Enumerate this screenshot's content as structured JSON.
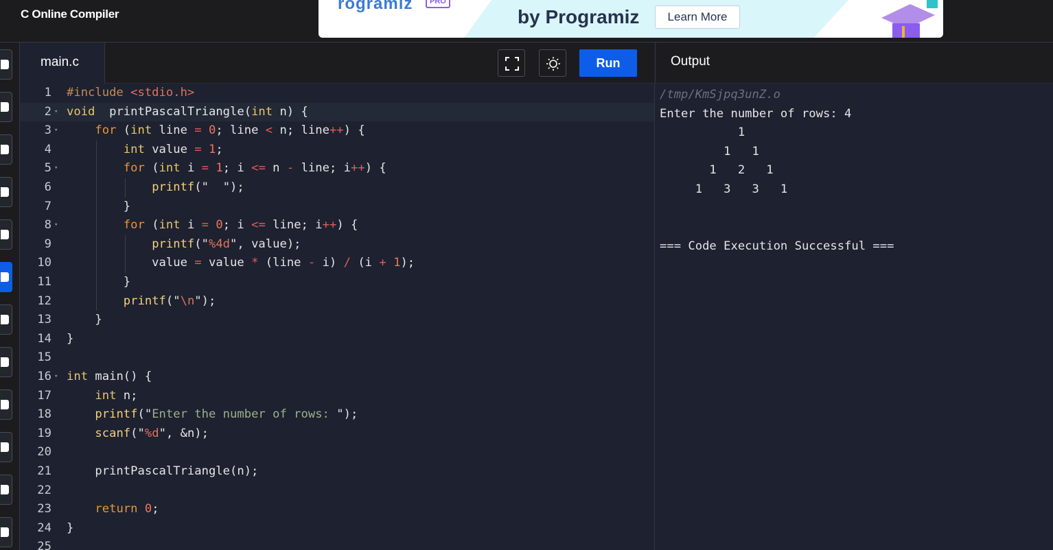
{
  "app": {
    "title": "C Online Compiler"
  },
  "banner": {
    "brand": "rogramiz",
    "pro": "PRO",
    "tagline": "by Programiz",
    "cta": "Learn More"
  },
  "editor": {
    "tab": "main.c",
    "run_label": "Run",
    "lines": [
      {
        "n": "1",
        "fold": false,
        "indent": 0
      },
      {
        "n": "2",
        "fold": true,
        "indent": 0
      },
      {
        "n": "3",
        "fold": true,
        "indent": 1
      },
      {
        "n": "4",
        "fold": false,
        "indent": 2
      },
      {
        "n": "5",
        "fold": true,
        "indent": 2
      },
      {
        "n": "6",
        "fold": false,
        "indent": 3
      },
      {
        "n": "7",
        "fold": false,
        "indent": 2
      },
      {
        "n": "8",
        "fold": true,
        "indent": 2
      },
      {
        "n": "9",
        "fold": false,
        "indent": 3
      },
      {
        "n": "10",
        "fold": false,
        "indent": 3
      },
      {
        "n": "11",
        "fold": false,
        "indent": 2
      },
      {
        "n": "12",
        "fold": false,
        "indent": 2
      },
      {
        "n": "13",
        "fold": false,
        "indent": 1
      },
      {
        "n": "14",
        "fold": false,
        "indent": 0
      },
      {
        "n": "15",
        "fold": false,
        "indent": 0
      },
      {
        "n": "16",
        "fold": true,
        "indent": 0
      },
      {
        "n": "17",
        "fold": false,
        "indent": 1
      },
      {
        "n": "18",
        "fold": false,
        "indent": 1
      },
      {
        "n": "19",
        "fold": false,
        "indent": 1
      },
      {
        "n": "20",
        "fold": false,
        "indent": 0
      },
      {
        "n": "21",
        "fold": false,
        "indent": 1
      },
      {
        "n": "22",
        "fold": false,
        "indent": 0
      },
      {
        "n": "23",
        "fold": false,
        "indent": 1
      },
      {
        "n": "24",
        "fold": false,
        "indent": 0
      },
      {
        "n": "25",
        "fold": false,
        "indent": 0
      }
    ],
    "code": [
      [
        [
          "inc",
          "#include "
        ],
        [
          "hdr",
          "<stdio.h>"
        ]
      ],
      [
        [
          "kw",
          "void"
        ],
        [
          "",
          "  printPascalTriangle("
        ],
        [
          "kw",
          "int"
        ],
        [
          "",
          " n) {"
        ]
      ],
      [
        [
          "",
          "    "
        ],
        [
          "ctl",
          "for"
        ],
        [
          "",
          " ("
        ],
        [
          "kw",
          "int"
        ],
        [
          "",
          " line "
        ],
        [
          "op",
          "="
        ],
        [
          "",
          ""
        ],
        [
          "num",
          " 0"
        ],
        [
          "",
          "; line "
        ],
        [
          "op",
          "<"
        ],
        [
          "",
          " n; line"
        ],
        [
          "op",
          "++"
        ],
        [
          "",
          ") {"
        ]
      ],
      [
        [
          "",
          "        "
        ],
        [
          "kw",
          "int"
        ],
        [
          "",
          " value "
        ],
        [
          "op",
          "="
        ],
        [
          "num",
          " 1"
        ],
        [
          "",
          ";"
        ]
      ],
      [
        [
          "",
          "        "
        ],
        [
          "ctl",
          "for"
        ],
        [
          "",
          " ("
        ],
        [
          "kw",
          "int"
        ],
        [
          "",
          " i "
        ],
        [
          "op",
          "="
        ],
        [
          "num",
          " 1"
        ],
        [
          "",
          "; i "
        ],
        [
          "op",
          "<="
        ],
        [
          "",
          " n "
        ],
        [
          "op",
          "-"
        ],
        [
          "",
          " line; i"
        ],
        [
          "op",
          "++"
        ],
        [
          "",
          ") {"
        ]
      ],
      [
        [
          "",
          "            "
        ],
        [
          "fn",
          "printf"
        ],
        [
          "",
          "(\""
        ],
        [
          "str",
          "  "
        ],
        [
          "",
          "\");"
        ]
      ],
      [
        [
          "",
          "        }"
        ]
      ],
      [
        [
          "",
          "        "
        ],
        [
          "ctl",
          "for"
        ],
        [
          "",
          " ("
        ],
        [
          "kw",
          "int"
        ],
        [
          "",
          " i "
        ],
        [
          "op",
          "="
        ],
        [
          "num",
          " 0"
        ],
        [
          "",
          "; i "
        ],
        [
          "op",
          "<="
        ],
        [
          "",
          " line; i"
        ],
        [
          "op",
          "++"
        ],
        [
          "",
          ") {"
        ]
      ],
      [
        [
          "",
          "            "
        ],
        [
          "fn",
          "printf"
        ],
        [
          "",
          "(\""
        ],
        [
          "str",
          "%4d"
        ],
        [
          "",
          "\", value);"
        ]
      ],
      [
        [
          "",
          "            value "
        ],
        [
          "op",
          "="
        ],
        [
          "",
          " value "
        ],
        [
          "op",
          "*"
        ],
        [
          "",
          " (line "
        ],
        [
          "op",
          "-"
        ],
        [
          "",
          " i) "
        ],
        [
          "op",
          "/"
        ],
        [
          "",
          " (i "
        ],
        [
          "op",
          "+"
        ],
        [
          "num",
          " 1"
        ],
        [
          "",
          ");"
        ]
      ],
      [
        [
          "",
          "        }"
        ]
      ],
      [
        [
          "",
          "        "
        ],
        [
          "fn",
          "printf"
        ],
        [
          "",
          "(\""
        ],
        [
          "str",
          "\\n"
        ],
        [
          "",
          "\");"
        ]
      ],
      [
        [
          "",
          "    }"
        ]
      ],
      [
        [
          "",
          "}"
        ]
      ],
      [
        [
          "",
          ""
        ]
      ],
      [
        [
          "kw",
          "int"
        ],
        [
          "",
          " main() {"
        ]
      ],
      [
        [
          "",
          "    "
        ],
        [
          "kw",
          "int"
        ],
        [
          "",
          " n;"
        ]
      ],
      [
        [
          "",
          "    "
        ],
        [
          "fn",
          "printf"
        ],
        [
          "",
          "(\""
        ],
        [
          "txt",
          "Enter the number of rows: "
        ],
        [
          "",
          "\");"
        ]
      ],
      [
        [
          "",
          "    "
        ],
        [
          "fn",
          "scanf"
        ],
        [
          "",
          "(\""
        ],
        [
          "str",
          "%d"
        ],
        [
          "",
          "\", &n);"
        ]
      ],
      [
        [
          "",
          ""
        ]
      ],
      [
        [
          "",
          "    printPascalTriangle(n);"
        ]
      ],
      [
        [
          "",
          ""
        ]
      ],
      [
        [
          "",
          "    "
        ],
        [
          "ctl",
          "return"
        ],
        [
          "num",
          " 0"
        ],
        [
          "",
          ";"
        ]
      ],
      [
        [
          "",
          "}"
        ]
      ],
      [
        [
          "",
          ""
        ]
      ]
    ]
  },
  "output": {
    "title": "Output",
    "lines": [
      "/tmp/KmSjpq3unZ.o",
      "Enter the number of rows: 4",
      "           1",
      "         1   1",
      "       1   2   1",
      "     1   3   3   1",
      "",
      "",
      "=== Code Execution Successful ==="
    ]
  },
  "icons": {
    "fullscreen": "fullscreen-icon",
    "theme": "sun-icon"
  }
}
